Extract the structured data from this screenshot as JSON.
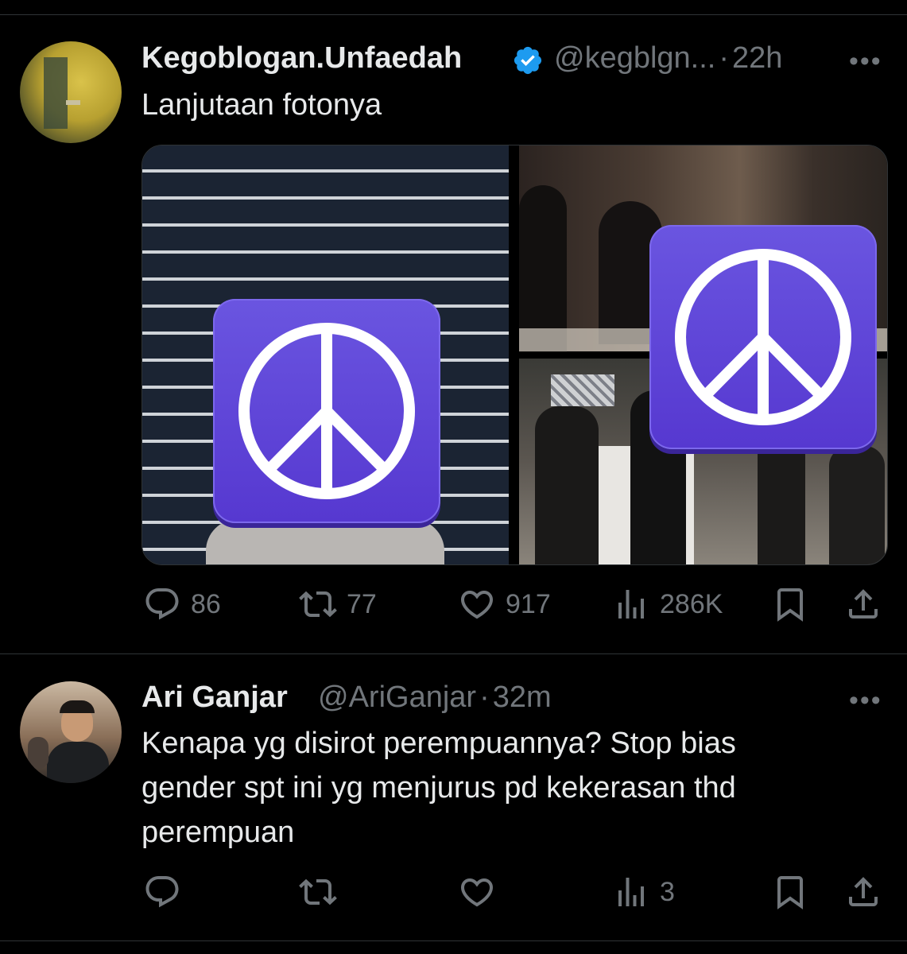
{
  "tweet1": {
    "author": "Kegoblogan.Unfaedah",
    "handle": "@kegblgn...",
    "separator": "·",
    "time": "22h",
    "more": "•••",
    "text": "Lanjutaan fotonya",
    "verified_color": "#1d9bf0",
    "actions": {
      "reply": "86",
      "retweet": "77",
      "like": "917",
      "views": "286K"
    }
  },
  "tweet2": {
    "author": "Ari Ganjar",
    "handle": "@AriGanjar",
    "separator": "·",
    "time": "32m",
    "more": "•••",
    "text_lines": [
      "Kenapa yg disirot perempuannya? Stop bias",
      "gender spt ini yg menjurus pd kekerasan thd",
      "perempuan"
    ],
    "actions": {
      "views": "3"
    }
  },
  "colors": {
    "background": "#000000",
    "text": "#e7e9ea",
    "muted": "#71767b",
    "peace_sticker": "#5b3fd6"
  },
  "icons": {
    "reply": "reply-icon",
    "retweet": "retweet-icon",
    "like": "heart-icon",
    "views": "views-icon",
    "bookmark": "bookmark-icon",
    "share": "share-icon",
    "verified": "verified-badge-icon",
    "sticker": "peace-sign-icon"
  }
}
